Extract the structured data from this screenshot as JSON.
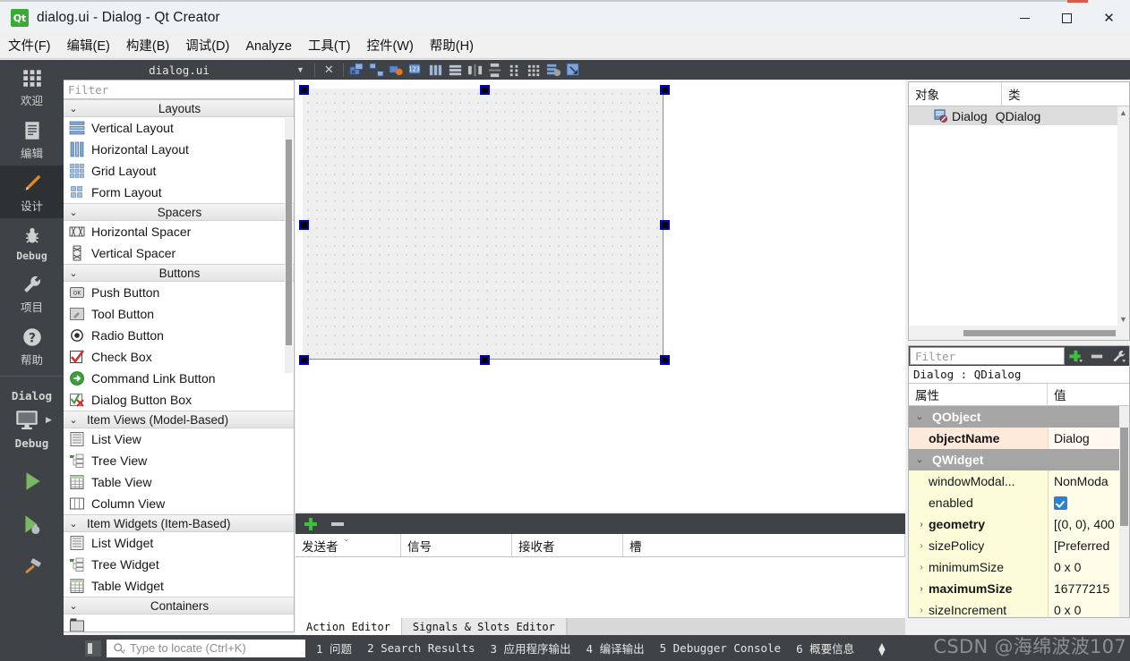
{
  "window": {
    "title": "dialog.ui - Dialog - Qt Creator",
    "app_icon": "qt-logo-icon",
    "minimize": "minimize-icon",
    "maximize": "maximize-icon",
    "close": "close-icon",
    "accent_color": "#d9594a"
  },
  "menubar": [
    {
      "label": "文件(F)",
      "mnemonic": "F"
    },
    {
      "label": "编辑(E)",
      "mnemonic": "E"
    },
    {
      "label": "构建(B)",
      "mnemonic": "B"
    },
    {
      "label": "调试(D)",
      "mnemonic": "D"
    },
    {
      "label": "Analyze",
      "mnemonic": "A"
    },
    {
      "label": "工具(T)",
      "mnemonic": "T"
    },
    {
      "label": "控件(W)",
      "mnemonic": "W"
    },
    {
      "label": "帮助(H)",
      "mnemonic": "H"
    }
  ],
  "modebar": {
    "modes": [
      {
        "label": "欢迎",
        "icon": "grid-icon",
        "active": false
      },
      {
        "label": "编辑",
        "icon": "document-icon",
        "active": false
      },
      {
        "label": "设计",
        "icon": "pencil-icon",
        "active": true
      },
      {
        "label": "Debug",
        "icon": "bug-icon",
        "active": false
      },
      {
        "label": "项目",
        "icon": "wrench-icon",
        "active": false
      },
      {
        "label": "帮助",
        "icon": "question-icon",
        "active": false
      }
    ],
    "kit": {
      "project": "Dialog",
      "config": "Debug",
      "icon": "desktop-icon"
    },
    "actions": [
      {
        "name": "run",
        "icon": "play-icon"
      },
      {
        "name": "debug",
        "icon": "play-bug-icon"
      },
      {
        "name": "build",
        "icon": "hammer-icon"
      }
    ]
  },
  "editor": {
    "tab_title": "dialog.ui",
    "tab_dropdown": "chevron-down-icon",
    "tab_close": "close-icon",
    "toolbar_buttons": [
      "edit-widgets-icon",
      "edit-signals-slots-icon",
      "edit-buddies-icon",
      "edit-tab-order-icon",
      "layout-horizontal-icon",
      "layout-vertical-icon",
      "layout-splitter-h-icon",
      "layout-splitter-v-icon",
      "layout-form-icon",
      "layout-grid-icon",
      "break-layout-icon",
      "adjust-size-icon"
    ]
  },
  "widgetbox": {
    "filter_placeholder": "Filter",
    "groups": [
      {
        "name": "Layouts",
        "expanded": true,
        "centered": true,
        "items": [
          {
            "label": "Vertical Layout",
            "icon": "vertical-layout-icon"
          },
          {
            "label": "Horizontal Layout",
            "icon": "horizontal-layout-icon"
          },
          {
            "label": "Grid Layout",
            "icon": "grid-layout-icon"
          },
          {
            "label": "Form Layout",
            "icon": "form-layout-icon"
          }
        ]
      },
      {
        "name": "Spacers",
        "expanded": true,
        "centered": true,
        "items": [
          {
            "label": "Horizontal Spacer",
            "icon": "horizontal-spacer-icon"
          },
          {
            "label": "Vertical Spacer",
            "icon": "vertical-spacer-icon"
          }
        ]
      },
      {
        "name": "Buttons",
        "expanded": true,
        "centered": true,
        "items": [
          {
            "label": "Push Button",
            "icon": "push-button-icon"
          },
          {
            "label": "Tool Button",
            "icon": "tool-button-icon"
          },
          {
            "label": "Radio Button",
            "icon": "radio-button-icon"
          },
          {
            "label": "Check Box",
            "icon": "check-box-icon"
          },
          {
            "label": "Command Link Button",
            "icon": "command-link-icon"
          },
          {
            "label": "Dialog Button Box",
            "icon": "dialog-button-box-icon"
          }
        ]
      },
      {
        "name": "Item Views (Model-Based)",
        "expanded": true,
        "centered": false,
        "items": [
          {
            "label": "List View",
            "icon": "list-view-icon"
          },
          {
            "label": "Tree View",
            "icon": "tree-view-icon"
          },
          {
            "label": "Table View",
            "icon": "table-view-icon"
          },
          {
            "label": "Column View",
            "icon": "column-view-icon"
          }
        ]
      },
      {
        "name": "Item Widgets (Item-Based)",
        "expanded": true,
        "centered": false,
        "items": [
          {
            "label": "List Widget",
            "icon": "list-widget-icon"
          },
          {
            "label": "Tree Widget",
            "icon": "tree-widget-icon"
          },
          {
            "label": "Table Widget",
            "icon": "table-widget-icon"
          }
        ]
      },
      {
        "name": "Containers",
        "expanded": true,
        "centered": true,
        "items": []
      }
    ]
  },
  "canvas": {
    "form_name": "Dialog",
    "selected": true,
    "handles": 8
  },
  "signals_slots": {
    "add_label": "+",
    "remove_label": "−",
    "columns": [
      "发送者",
      "信号",
      "接收者",
      "槽"
    ],
    "rows": []
  },
  "editor_tabs": [
    {
      "label": "Action Editor",
      "active": true
    },
    {
      "label": "Signals & Slots Editor",
      "active": false
    }
  ],
  "object_inspector": {
    "columns": [
      "对象",
      "类"
    ],
    "rows": [
      {
        "object": "Dialog",
        "class": "QDialog",
        "icon": "qdialog-icon",
        "selected": true
      }
    ]
  },
  "property_editor": {
    "filter_placeholder": "Filter",
    "toolbar": [
      {
        "name": "add-property-button",
        "icon": "plus-icon"
      },
      {
        "name": "remove-property-button",
        "icon": "minus-icon"
      },
      {
        "name": "configure-button",
        "icon": "wrench-icon"
      }
    ],
    "object_header": "Dialog : QDialog",
    "columns": [
      "属性",
      "值"
    ],
    "rows": [
      {
        "kind": "group",
        "name": "QObject",
        "value": "",
        "expander": "chevron-down-icon"
      },
      {
        "kind": "prop",
        "name": "objectName",
        "value": "Dialog",
        "bold": true,
        "tint": "peach",
        "expander": ""
      },
      {
        "kind": "group",
        "name": "QWidget",
        "value": "",
        "expander": "chevron-down-icon"
      },
      {
        "kind": "prop",
        "name": "windowModal...",
        "value": "NonModa",
        "bold": false,
        "tint": "yellow",
        "expander": ""
      },
      {
        "kind": "prop",
        "name": "enabled",
        "value": "",
        "bold": false,
        "tint": "yellow",
        "expander": "",
        "checkbox": true
      },
      {
        "kind": "prop",
        "name": "geometry",
        "value": "[(0, 0), 400",
        "bold": true,
        "tint": "yellow",
        "expander": "chevron-right-icon"
      },
      {
        "kind": "prop",
        "name": "sizePolicy",
        "value": "[Preferred",
        "bold": false,
        "tint": "yellow",
        "expander": "chevron-right-icon"
      },
      {
        "kind": "prop",
        "name": "minimumSize",
        "value": "0 x 0",
        "bold": false,
        "tint": "yellow",
        "expander": "chevron-right-icon"
      },
      {
        "kind": "prop",
        "name": "maximumSize",
        "value": "16777215",
        "bold": true,
        "tint": "yellow",
        "expander": "chevron-right-icon"
      },
      {
        "kind": "prop",
        "name": "sizeIncrement",
        "value": "0 x 0",
        "bold": false,
        "tint": "yellow",
        "expander": "chevron-right-icon"
      }
    ]
  },
  "statusbar": {
    "locator_placeholder": "Type to locate (Ctrl+K)",
    "locator_icon": "search-icon",
    "sidebar_toggle_icon": "sidebar-icon",
    "outputs": [
      "1 问题",
      "2 Search Results",
      "3 应用程序输出",
      "4 编译输出",
      "5 Debugger Console",
      "6 概要信息"
    ],
    "resize_icon": "updown-icon"
  },
  "watermark": "CSDN @海绵波波107"
}
